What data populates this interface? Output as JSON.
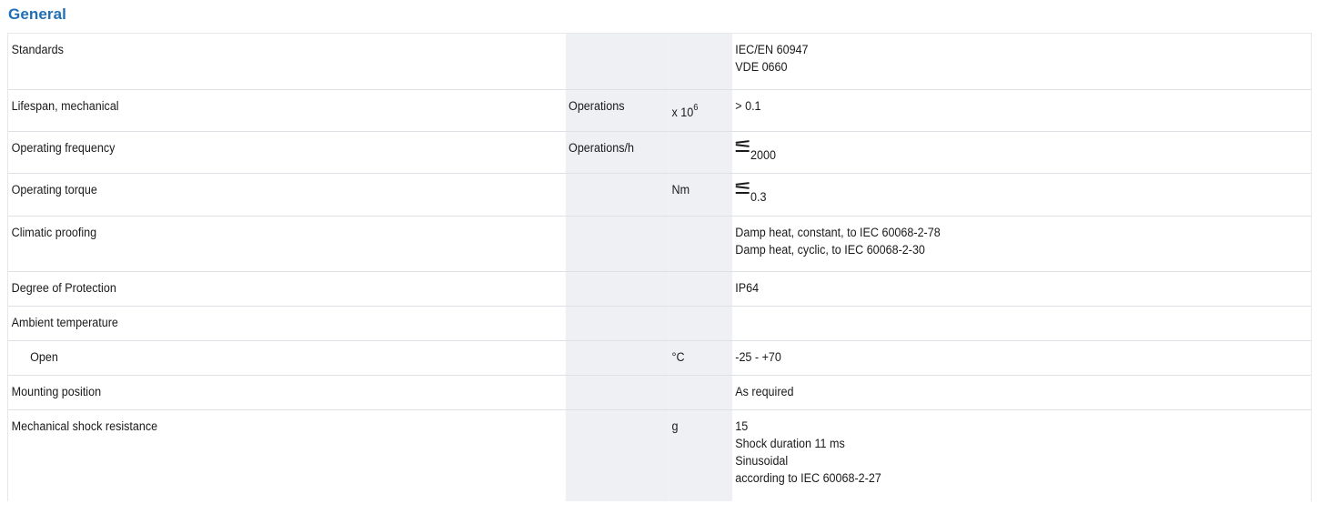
{
  "section_title": "General",
  "rows": [
    {
      "label": "Standards",
      "unit": "",
      "factor": "",
      "value_lines": [
        "IEC/EN 60947",
        "VDE 0660"
      ]
    },
    {
      "label": "Lifespan, mechanical",
      "unit": "Operations",
      "factor": "x 10",
      "factor_exp": "6",
      "value_lines": [
        "> 0.1"
      ]
    },
    {
      "label": "Operating frequency",
      "unit": "Operations/h",
      "factor": "",
      "value_prefix": "≤",
      "value_lines": [
        "2000"
      ]
    },
    {
      "label": "Operating torque",
      "unit": "",
      "factor": "Nm",
      "value_prefix": "≤",
      "value_lines": [
        "0.3"
      ]
    },
    {
      "label": "Climatic proofing",
      "unit": "",
      "factor": "",
      "value_lines": [
        "Damp heat, constant, to IEC 60068-2-78",
        "Damp heat, cyclic, to IEC 60068-2-30"
      ]
    },
    {
      "label": "Degree of Protection",
      "unit": "",
      "factor": "",
      "value_lines": [
        "IP64"
      ]
    },
    {
      "label": "Ambient temperature",
      "unit": "",
      "factor": "",
      "value_lines": [
        ""
      ]
    },
    {
      "label": "Open",
      "unit": "",
      "factor": "°C",
      "value_lines": [
        "-25 - +70"
      ]
    },
    {
      "label": "Mounting position",
      "unit": "",
      "factor": "",
      "value_lines": [
        "As required"
      ]
    },
    {
      "label": "Mechanical shock resistance",
      "unit": "",
      "factor": "g",
      "value_lines": [
        "15",
        "Shock duration 11 ms",
        "Sinusoidal",
        "according to IEC 60068-2-27"
      ]
    }
  ]
}
